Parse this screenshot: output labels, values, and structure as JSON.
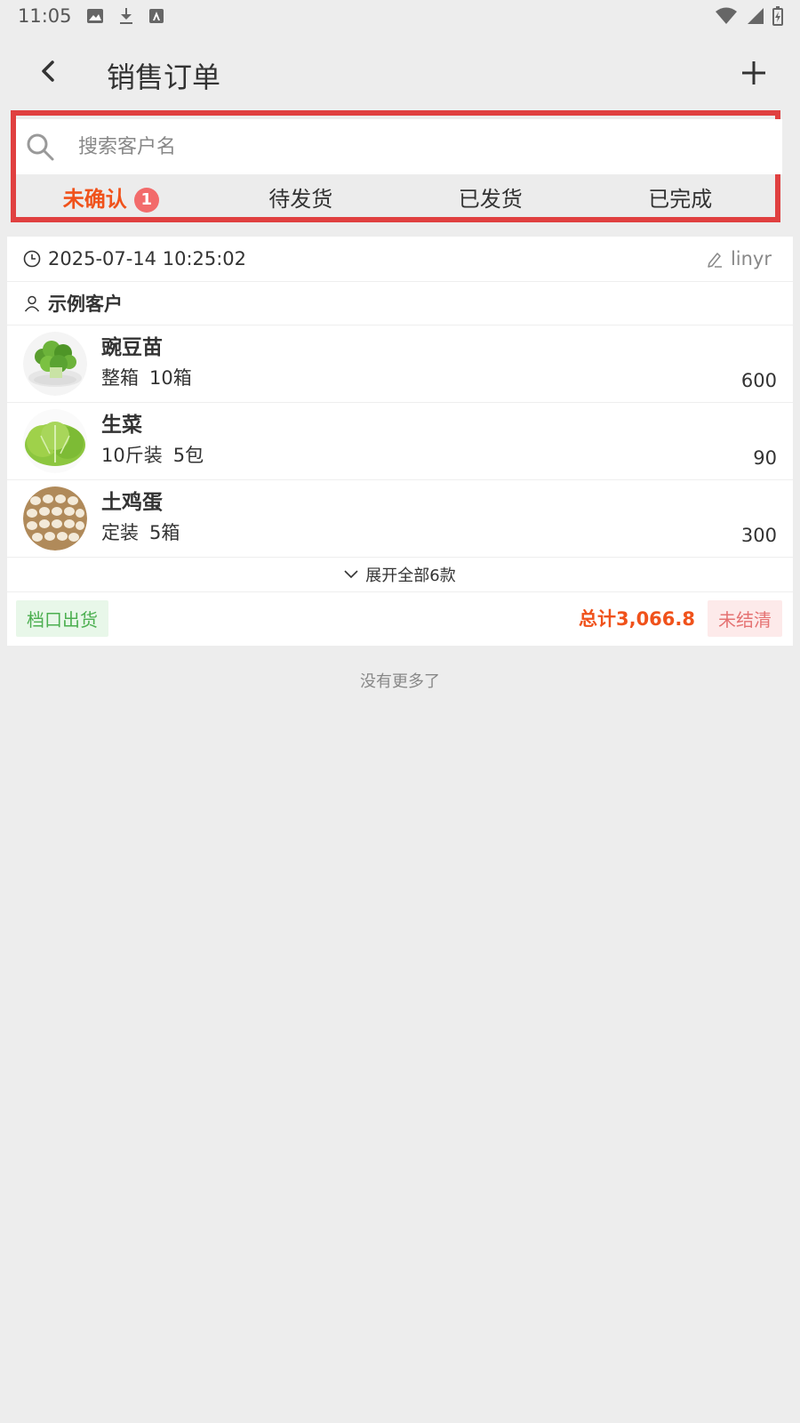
{
  "status_bar": {
    "time": "11:05"
  },
  "header": {
    "title": "销售订单"
  },
  "search": {
    "placeholder": "搜索客户名"
  },
  "tabs": [
    {
      "label": "未确认",
      "badge": "1",
      "active": true
    },
    {
      "label": "待发货"
    },
    {
      "label": "已发货"
    },
    {
      "label": "已完成"
    }
  ],
  "order": {
    "datetime": "2025-07-14 10:25:02",
    "editor": "linyr",
    "customer": "示例客户",
    "items": [
      {
        "name": "豌豆苗",
        "spec": "整箱",
        "qty": "10箱",
        "amount": "600",
        "icon": "pea-shoots-image"
      },
      {
        "name": "生菜",
        "spec": "10斤装",
        "qty": "5包",
        "amount": "90",
        "icon": "lettuce-image"
      },
      {
        "name": "土鸡蛋",
        "spec": "定装",
        "qty": "5箱",
        "amount": "300",
        "icon": "eggs-image"
      }
    ],
    "expand_label": "展开全部6款",
    "delivery_tag": "档口出货",
    "total": "总计3,066.8",
    "payment_status": "未结清"
  },
  "footer": {
    "no_more": "没有更多了"
  },
  "colors": {
    "accent": "#f0521b",
    "highlight_border": "#e04040",
    "badge": "#f26b6b",
    "green_tag": "#4caf50"
  }
}
